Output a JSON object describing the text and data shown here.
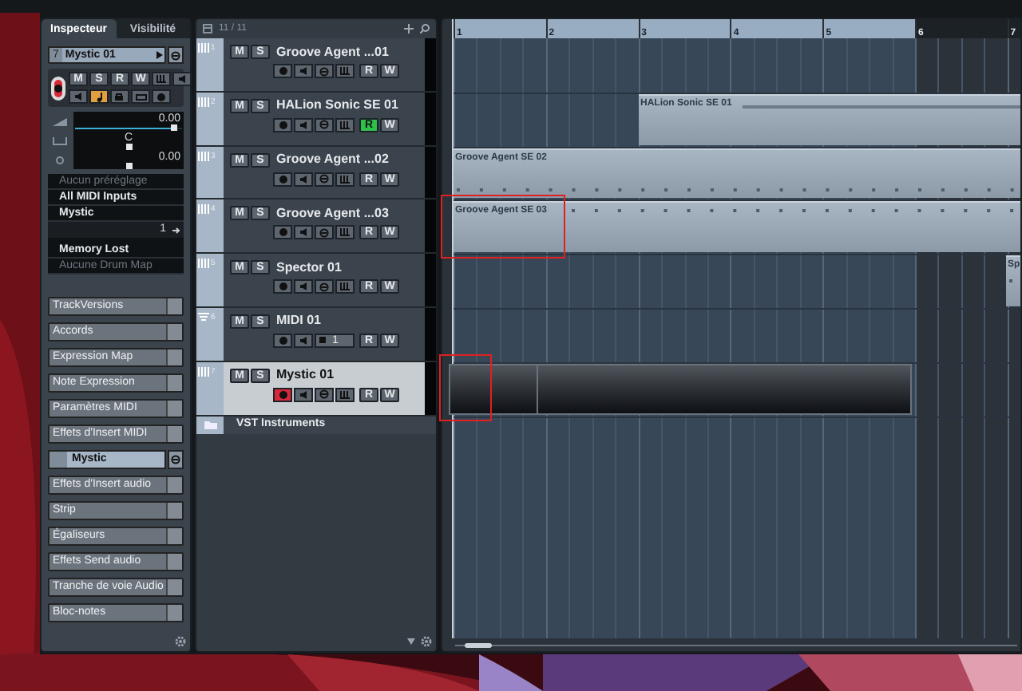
{
  "inspector": {
    "tabs": [
      {
        "label": "Inspecteur",
        "selected": true
      },
      {
        "label": "Visibilité",
        "selected": false
      }
    ],
    "track": {
      "number": "7",
      "name": "Mystic 01",
      "mute": "M",
      "solo": "S",
      "read": "R",
      "write": "W",
      "record_on": true
    },
    "faders": [
      {
        "kind": "volume",
        "reading": "0.00",
        "level": 0.93
      },
      {
        "kind": "pan",
        "reading": "C",
        "level": 0.5
      },
      {
        "kind": "delay",
        "reading": "0.00",
        "level": 0.5
      }
    ],
    "routing": [
      {
        "kind": "preset",
        "text": "Aucun préréglage",
        "disabled": true
      },
      {
        "kind": "input",
        "text": "All MIDI Inputs",
        "disabled": false
      },
      {
        "kind": "output",
        "text": "Mystic",
        "disabled": false
      },
      {
        "kind": "channel",
        "text": "1",
        "disabled": false
      },
      {
        "kind": "program",
        "text": "Memory Lost",
        "disabled": false
      },
      {
        "kind": "drum_map",
        "text": "Aucune Drum Map",
        "disabled": true
      }
    ],
    "sections": [
      {
        "label": "TrackVersions",
        "kind": "section"
      },
      {
        "label": "Accords",
        "kind": "section"
      },
      {
        "label": "Expression Map",
        "kind": "section"
      },
      {
        "label": "Note Expression",
        "kind": "section"
      },
      {
        "label": "Paramètres MIDI",
        "kind": "section"
      },
      {
        "label": "Effets d'Insert MIDI",
        "kind": "section"
      },
      {
        "label": "Mystic",
        "kind": "channel"
      },
      {
        "label": "Effets d'Insert audio",
        "kind": "section"
      },
      {
        "label": "Strip",
        "kind": "section"
      },
      {
        "label": "Égaliseurs",
        "kind": "section"
      },
      {
        "label": "Effets Send audio",
        "kind": "section"
      },
      {
        "label": "Tranche de voie Audio",
        "kind": "section"
      },
      {
        "label": "Bloc-notes",
        "kind": "section"
      }
    ]
  },
  "track_list": {
    "count": "11 / 11",
    "tracks": [
      {
        "number": "1",
        "name": "Groove Agent ...01",
        "kind": "instrument",
        "selected": false,
        "mute": "M",
        "solo": "S",
        "read": "R",
        "write": "W",
        "read_on": false,
        "record_on": false
      },
      {
        "number": "2",
        "name": "HALion Sonic SE 01",
        "kind": "instrument",
        "selected": false,
        "mute": "M",
        "solo": "S",
        "read": "R",
        "write": "W",
        "read_on": true,
        "record_on": false
      },
      {
        "number": "3",
        "name": "Groove Agent ...02",
        "kind": "instrument",
        "selected": false,
        "mute": "M",
        "solo": "S",
        "read": "R",
        "write": "W",
        "read_on": false,
        "record_on": false
      },
      {
        "number": "4",
        "name": "Groove Agent ...03",
        "kind": "instrument",
        "selected": false,
        "mute": "M",
        "solo": "S",
        "read": "R",
        "write": "W",
        "read_on": false,
        "record_on": false
      },
      {
        "number": "5",
        "name": "Spector 01",
        "kind": "instrument",
        "selected": false,
        "mute": "M",
        "solo": "S",
        "read": "R",
        "write": "W",
        "read_on": false,
        "record_on": false
      },
      {
        "number": "6",
        "name": "MIDI 01",
        "kind": "midi",
        "channel": "1",
        "selected": false,
        "mute": "M",
        "solo": "S",
        "read": "R",
        "write": "W",
        "read_on": false,
        "record_on": false
      },
      {
        "number": "7",
        "name": "Mystic 01",
        "kind": "instrument",
        "selected": true,
        "mute": "M",
        "solo": "S",
        "read": "R",
        "write": "W",
        "read_on": false,
        "record_on": true
      }
    ],
    "folder": {
      "name": "VST Instruments"
    }
  },
  "arrange": {
    "ruler": [
      {
        "label": "1",
        "in_cycle": true
      },
      {
        "label": "2",
        "in_cycle": true
      },
      {
        "label": "3",
        "in_cycle": true
      },
      {
        "label": "4",
        "in_cycle": true
      },
      {
        "label": "5",
        "in_cycle": true
      },
      {
        "label": "6",
        "in_cycle": false
      },
      {
        "label": "7",
        "in_cycle": false
      }
    ],
    "lanes": [
      {
        "kind": "empty"
      },
      {
        "kind": "event",
        "event": {
          "kind": "part",
          "name": "HALion Sonic SE 01"
        }
      },
      {
        "kind": "event",
        "event": {
          "kind": "drum_part",
          "name": "Groove Agent SE 02"
        }
      },
      {
        "kind": "event",
        "event": {
          "kind": "drum_part",
          "name": "Groove Agent SE 03"
        }
      },
      {
        "kind": "event",
        "event": {
          "kind": "drum_part",
          "name": "Sp"
        }
      },
      {
        "kind": "empty"
      },
      {
        "kind": "event",
        "event": {
          "kind": "dark_part"
        }
      }
    ]
  }
}
